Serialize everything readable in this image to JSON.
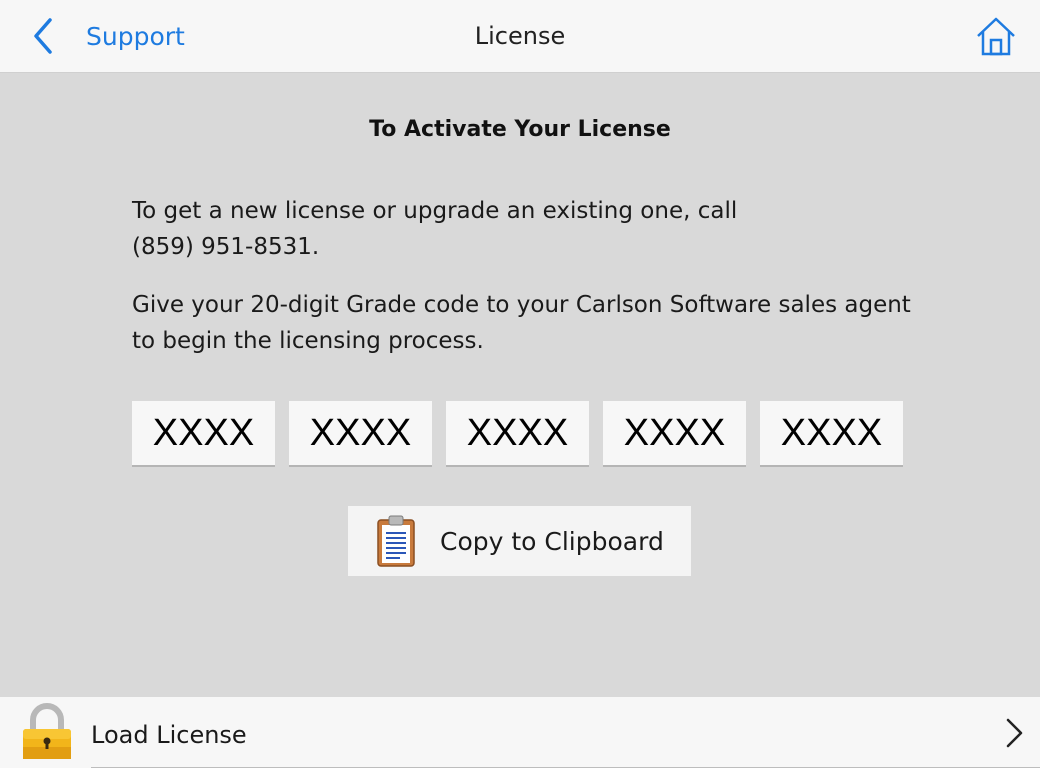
{
  "header": {
    "back_label": "Support",
    "title": "License",
    "icons": {
      "back": "chevron-left-icon",
      "home": "home-icon"
    },
    "accent_color": "#1e7be0"
  },
  "main": {
    "heading": "To Activate Your License",
    "paragraph1_line1": "To get a new license or upgrade an existing one, call",
    "paragraph1_line2": "(859) 951-8531.",
    "paragraph2_line1": "Give your 20-digit Grade code to your Carlson Software sales agent",
    "paragraph2_line2": "to begin the licensing process.",
    "code_segments": [
      "XXXX",
      "XXXX",
      "XXXX",
      "XXXX",
      "XXXX"
    ],
    "copy_button": {
      "label": "Copy to Clipboard",
      "icon": "clipboard-icon"
    }
  },
  "footer": {
    "load_label": "Load License",
    "icons": {
      "lock": "lock-icon",
      "chevron": "chevron-right-icon"
    }
  }
}
